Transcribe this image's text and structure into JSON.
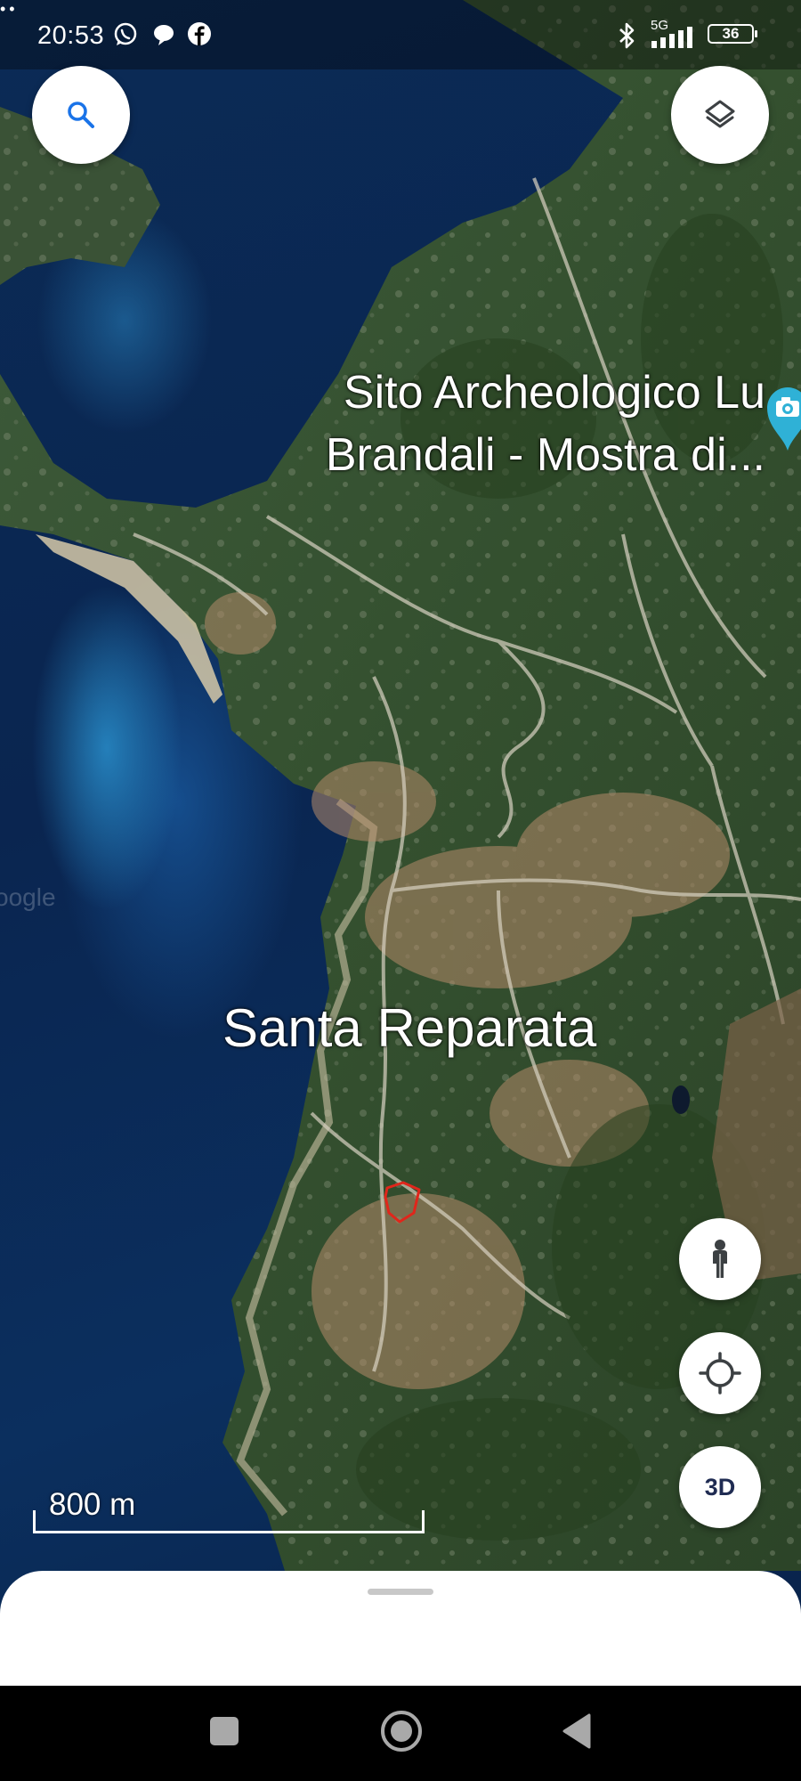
{
  "status_bar": {
    "time": "20:53",
    "notification_icons": [
      "whatsapp-icon",
      "chat-icon",
      "facebook-icon",
      "more-icon"
    ],
    "more_glyph": "••",
    "network_label": "5G",
    "battery_level": "36"
  },
  "map": {
    "poi_label": "Sito Archeologico Lu Brandali - Mostra di...",
    "place_label": "Santa Reparata",
    "watermark": "oogle",
    "scale_text": "800 m"
  },
  "controls": {
    "search_icon": "search-icon",
    "layers_icon": "layers-icon",
    "streetview_icon": "pegman-icon",
    "location_icon": "my-location-icon",
    "tilt_label": "3D"
  },
  "nav_bar": {
    "buttons": [
      "recents-button",
      "home-button",
      "back-button"
    ]
  },
  "colors": {
    "annotation": "#e0261b",
    "poi_pin": "#2fb1d6",
    "icon_blue": "#1a73e8",
    "icon_dark": "#3c4043"
  }
}
